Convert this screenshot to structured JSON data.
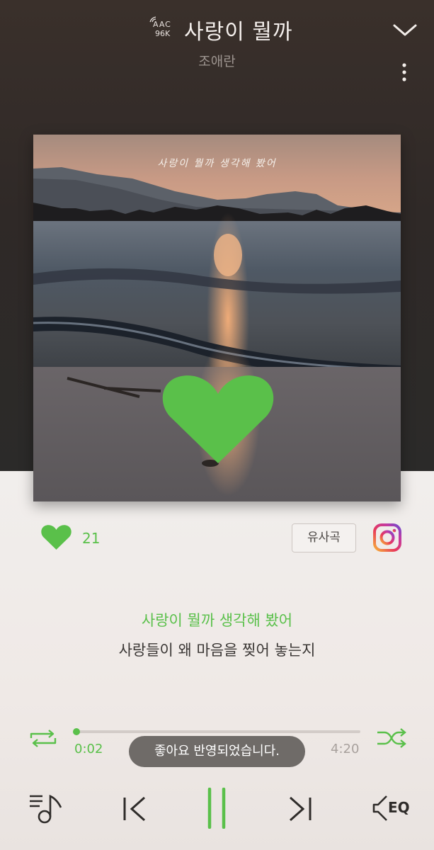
{
  "header": {
    "quality_codec": "AAC",
    "quality_bitrate": "96K",
    "title": "사랑이 뭘까",
    "artist": "조애란"
  },
  "album": {
    "overlay_text": "사랑이 뭘까 생각해 봤어",
    "heart_color": "#5ac04a"
  },
  "actions": {
    "like_count": "21",
    "similar_label": "유사곡",
    "liked": true
  },
  "lyrics": {
    "current": "사랑이 뭘까 생각해 봤어",
    "next": "사랑들이 왜 마음을 찢어 놓는지"
  },
  "player": {
    "elapsed": "0:02",
    "total": "4:20",
    "progress_fraction": 0.0077,
    "toast": "좋아요 반영되었습니다.",
    "eq_label": "EQ"
  },
  "colors": {
    "accent": "#5ac04a",
    "header_bg": "#352d29",
    "body_bg": "#efeae7"
  },
  "icons": {
    "collapse": "chevron-down-icon",
    "more": "more-vertical-icon",
    "like": "heart-icon",
    "instagram": "instagram-icon",
    "repeat": "repeat-icon",
    "shuffle": "shuffle-icon",
    "playlist": "playlist-icon",
    "prev": "skip-previous-icon",
    "pause": "pause-icon",
    "next": "skip-next-icon",
    "eq": "equalizer-icon"
  }
}
